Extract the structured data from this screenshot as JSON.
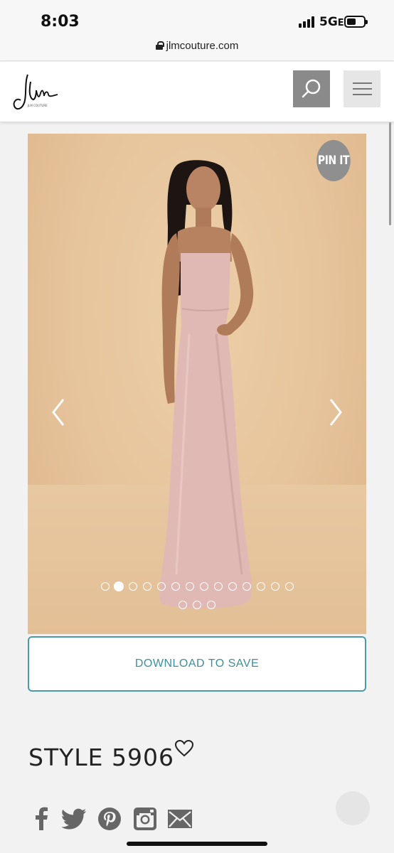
{
  "status_bar": {
    "time": "8:03",
    "network": "5G",
    "url": "jlmcouture.com"
  },
  "header": {
    "logo_alt": "JLM Couture",
    "search_icon": "search-icon",
    "menu_icon": "hamburger-menu-icon"
  },
  "gallery": {
    "pin_label": "PIN IT",
    "prev_icon": "chevron-left-icon",
    "next_icon": "chevron-right-icon",
    "dots_total": 16,
    "active_dot": 2
  },
  "download": {
    "label": "DOWNLOAD TO SAVE"
  },
  "product": {
    "style_label": "STYLE 5906",
    "favorite_icon": "heart-icon"
  },
  "social": [
    {
      "name": "facebook-icon"
    },
    {
      "name": "twitter-icon"
    },
    {
      "name": "pinterest-icon"
    },
    {
      "name": "instagram-icon"
    },
    {
      "name": "email-icon"
    }
  ],
  "colors": {
    "accent": "#4c9aa7",
    "dress": "#e0b9b5",
    "backdrop": "#e8c7a0"
  }
}
